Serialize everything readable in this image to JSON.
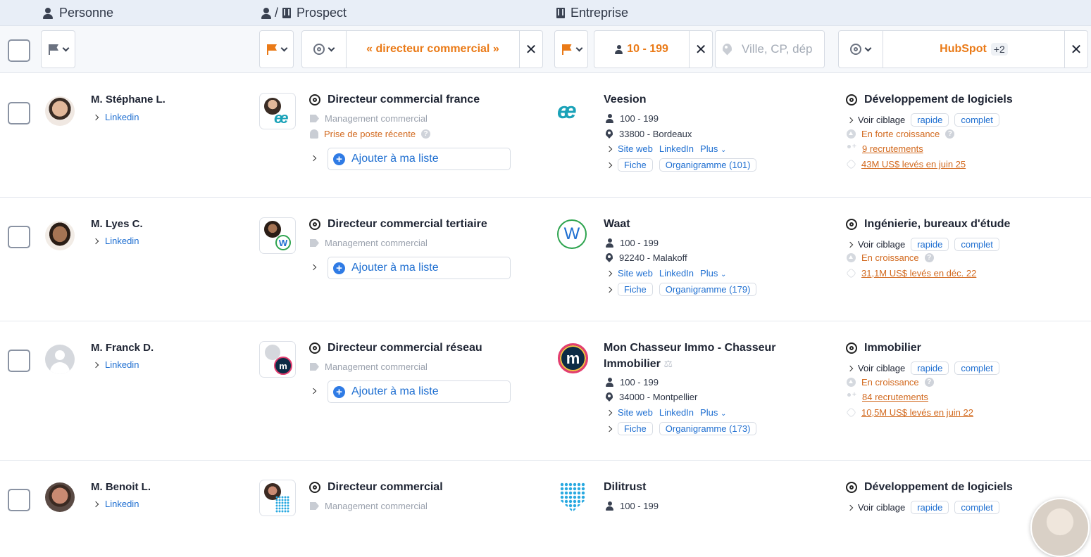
{
  "columns": {
    "personne": "Personne",
    "prospect": "Prospect",
    "prospect_sep": "/",
    "entreprise": "Entreprise"
  },
  "filters": {
    "prospect_keyword": "« directeur commercial »",
    "company_size": "10 - 199",
    "location_placeholder": "Ville, CP, dép",
    "tech": "HubSpot",
    "tech_more": "+2"
  },
  "common": {
    "linkedin": "Linkedin",
    "management": "Management commercial",
    "add_to_list": "Ajouter à ma liste",
    "site_web": "Site web",
    "linkedin_company": "LinkedIn",
    "plus": "Plus",
    "fiche": "Fiche",
    "voir_ciblage": "Voir ciblage",
    "rapide": "rapide",
    "complet": "complet"
  },
  "rows": [
    {
      "name": "M. Stéphane L.",
      "title": "Directeur commercial france",
      "recent": "Prise de poste récente",
      "company": "Veesion",
      "size": "100 - 199",
      "location": "33800 - Bordeaux",
      "organigramme": "Organigramme (101)",
      "sector": "Développement de logiciels",
      "growth": "En forte croissance",
      "hiring": "9 recrutements",
      "funding": "43M US$ levés en juin 25"
    },
    {
      "name": "M. Lyes C.",
      "title": "Directeur commercial tertiaire",
      "company": "Waat",
      "size": "100 - 199",
      "location": "92240 - Malakoff",
      "organigramme": "Organigramme (179)",
      "sector": "Ingénierie, bureaux d'étude",
      "growth": "En croissance",
      "funding": "31,1M US$ levés en déc. 22"
    },
    {
      "name": "M. Franck D.",
      "title": "Directeur commercial réseau",
      "company_line1": "Mon Chasseur Immo - Chasseur",
      "company_line2": "Immobilier",
      "size": "100 - 199",
      "location": "34000 - Montpellier",
      "organigramme": "Organigramme (173)",
      "sector": "Immobilier",
      "growth": "En croissance",
      "hiring": "84 recrutements",
      "funding": "10,5M US$ levés en juin 22"
    },
    {
      "name": "M. Benoit L.",
      "title": "Directeur commercial",
      "company": "Dilitrust",
      "size": "100 - 199",
      "sector": "Développement de logiciels"
    }
  ],
  "colors": {
    "accent_orange": "#ea7a17",
    "link_blue": "#1f6fd1",
    "header_bg": "#e8eef7"
  }
}
